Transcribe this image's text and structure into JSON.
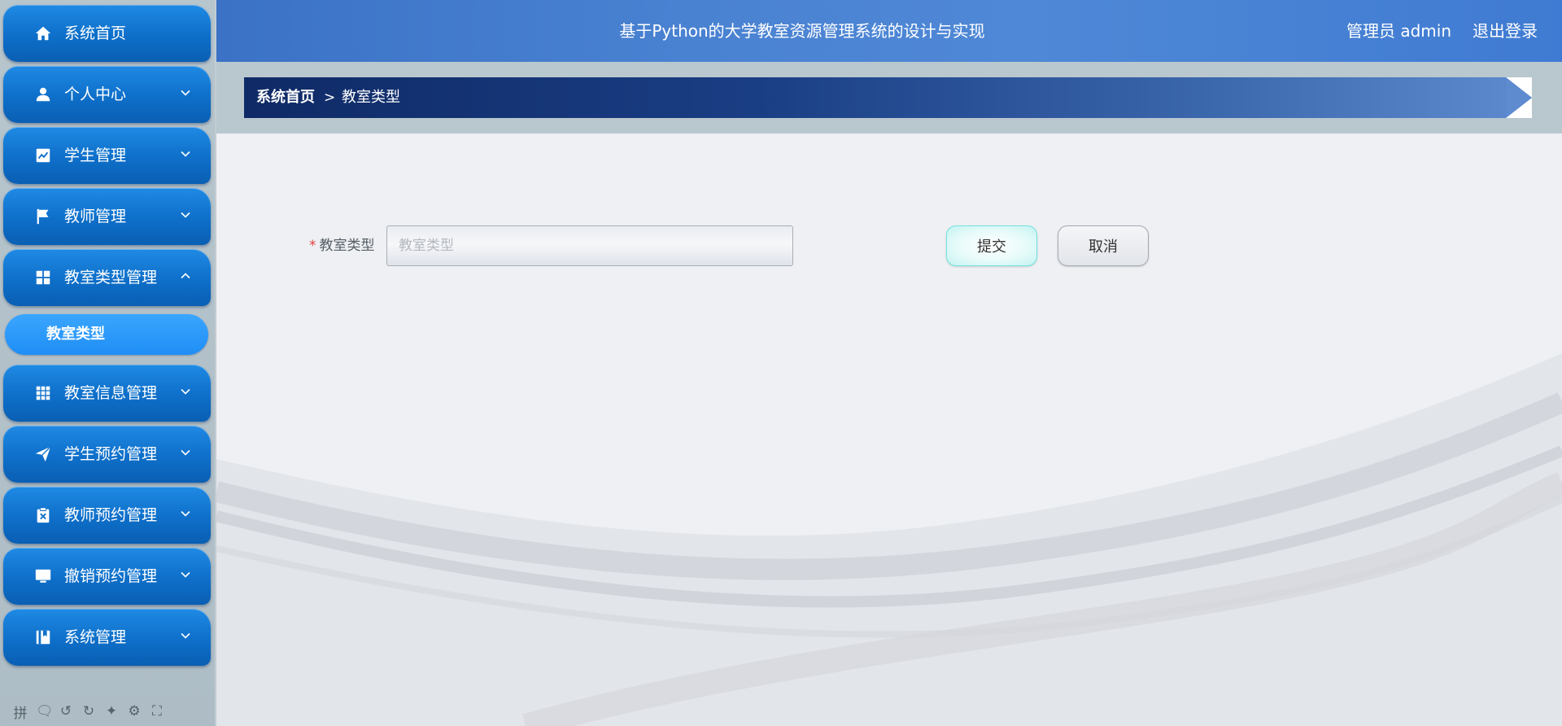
{
  "header": {
    "title": "基于Python的大学教室资源管理系统的设计与实现",
    "user": "管理员 admin",
    "logout": "退出登录"
  },
  "sidebar": {
    "items": [
      {
        "label": "系统首页",
        "icon": "home-icon",
        "chevron": "none"
      },
      {
        "label": "个人中心",
        "icon": "user-icon",
        "chevron": "down"
      },
      {
        "label": "学生管理",
        "icon": "chart-icon",
        "chevron": "down"
      },
      {
        "label": "教师管理",
        "icon": "flag-icon",
        "chevron": "down"
      },
      {
        "label": "教室类型管理",
        "icon": "grid-2x2-icon",
        "chevron": "up"
      },
      {
        "label": "教室信息管理",
        "icon": "grid-3x3-icon",
        "chevron": "down"
      },
      {
        "label": "学生预约管理",
        "icon": "send-icon",
        "chevron": "down"
      },
      {
        "label": "教师预约管理",
        "icon": "clipboard-x-icon",
        "chevron": "down"
      },
      {
        "label": "撤销预约管理",
        "icon": "monitor-icon",
        "chevron": "down"
      },
      {
        "label": "系统管理",
        "icon": "book-icon",
        "chevron": "down"
      }
    ],
    "submenu": {
      "label": "教室类型"
    },
    "ime_bar": [
      "拼",
      "🗨",
      "↺",
      "↻",
      "✦",
      "⚙",
      "⛶"
    ]
  },
  "breadcrumb": {
    "home": "系统首页",
    "separator": ">",
    "current": "教室类型"
  },
  "form": {
    "required_mark": "*",
    "label": "教室类型",
    "input_value": "",
    "input_placeholder": "教室类型",
    "submit_label": "提交",
    "cancel_label": "取消"
  },
  "colors": {
    "menu_blue": "#0e6fc9",
    "submenu_blue": "#2b98fb",
    "header_blue": "#4a82d2",
    "breadcrumb_navy": "#0f2a66",
    "required_red": "#e0413f",
    "submit_border": "#73e3e0"
  }
}
